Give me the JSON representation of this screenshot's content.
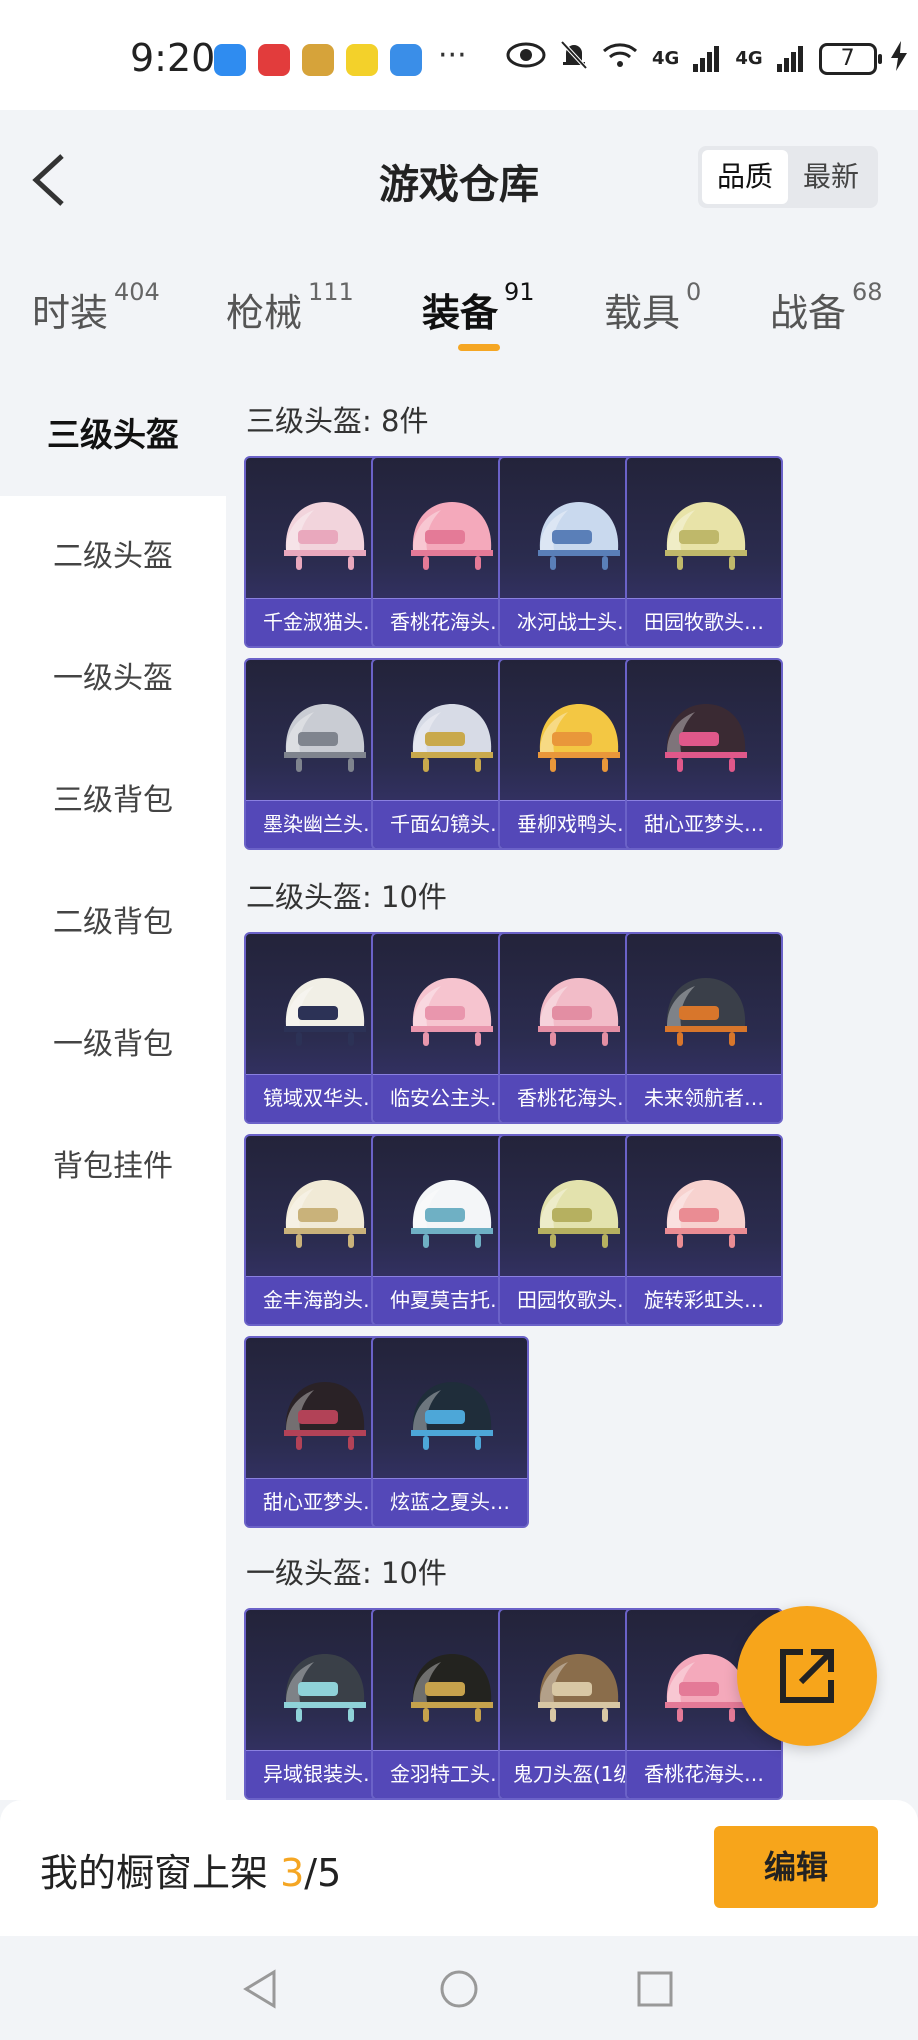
{
  "status_bar": {
    "time": "9:20",
    "more": "···",
    "net1": "4G",
    "net2": "4G",
    "battery": "7"
  },
  "header": {
    "title": "游戏仓库",
    "sort_options": [
      "品质",
      "最新"
    ],
    "sort_active": "品质"
  },
  "tabs": [
    {
      "label": "时装",
      "count": "404"
    },
    {
      "label": "枪械",
      "count": "111"
    },
    {
      "label": "装备",
      "count": "91"
    },
    {
      "label": "载具",
      "count": "0"
    },
    {
      "label": "战备",
      "count": "68"
    }
  ],
  "active_tab": "装备",
  "sidebar": {
    "items": [
      "三级头盔",
      "二级头盔",
      "一级头盔",
      "三级背包",
      "二级背包",
      "一级背包",
      "背包挂件"
    ],
    "active": "三级头盔"
  },
  "sections": [
    {
      "title": "三级头盔: 8件",
      "items": [
        "千金淑猫头…",
        "香桃花海头…",
        "冰河战士头…",
        "田园牧歌头…",
        "墨染幽兰头…",
        "千面幻镜头…",
        "垂柳戏鸭头…",
        "甜心亚梦头…"
      ]
    },
    {
      "title": "二级头盔: 10件",
      "items": [
        "镜域双华头…",
        "临安公主头…",
        "香桃花海头…",
        "未来领航者…",
        "金丰海韵头…",
        "仲夏莫吉托…",
        "田园牧歌头…",
        "旋转彩虹头…",
        "甜心亚梦头…",
        "炫蓝之夏头…"
      ]
    },
    {
      "title": "一级头盔: 10件",
      "items": [
        "异域银装头…",
        "金羽特工头…",
        "鬼刀头盔(1级)",
        "香桃花海头…"
      ]
    }
  ],
  "bottom_bar": {
    "label": "我的橱窗上架",
    "current": "3",
    "total": "/5",
    "edit_label": "编辑"
  },
  "colors": {
    "accent": "#f7a51b",
    "card_bg": "#2b2c4f",
    "card_band": "#5448b8"
  }
}
